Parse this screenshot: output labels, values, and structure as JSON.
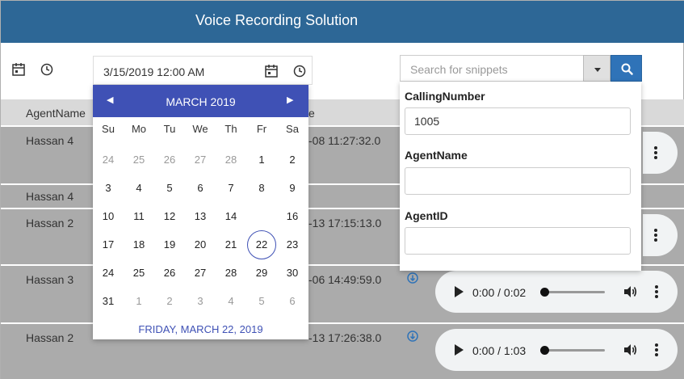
{
  "app": {
    "title": "Voice Recording Solution"
  },
  "filters": {
    "date_value": "3/15/2019 12:00 AM",
    "search_placeholder": "Search for snippets"
  },
  "table": {
    "headers": [
      "AgentName",
      "e"
    ],
    "rows": [
      {
        "agent": "Hassan 4",
        "datetime": "-08 11:27:32.0"
      },
      {
        "agent": "Hassan 4",
        "datetime": ""
      },
      {
        "agent": "Hassan 2",
        "datetime": "-13 17:15:13.0"
      },
      {
        "agent": "Hassan 3",
        "datetime": "-06 14:49:59.0",
        "player_time": "0:00 / 0:02",
        "progress": 0
      },
      {
        "agent": "Hassan 2",
        "datetime": "-13 17:26:38.0",
        "player_time": "0:00 / 1:03",
        "progress": 0
      }
    ]
  },
  "calendar": {
    "month_label": "MARCH 2019",
    "weekdays": [
      "Su",
      "Mo",
      "Tu",
      "We",
      "Th",
      "Fr",
      "Sa"
    ],
    "weeks": [
      [
        "24",
        "25",
        "26",
        "27",
        "28",
        "1",
        "2"
      ],
      [
        "3",
        "4",
        "5",
        "6",
        "7",
        "8",
        "9"
      ],
      [
        "10",
        "11",
        "12",
        "13",
        "14",
        "15",
        "16"
      ],
      [
        "17",
        "18",
        "19",
        "20",
        "21",
        "22",
        "23"
      ],
      [
        "24",
        "25",
        "26",
        "27",
        "28",
        "29",
        "30"
      ],
      [
        "31",
        "1",
        "2",
        "3",
        "4",
        "5",
        "6"
      ]
    ],
    "selected_day": "15",
    "today_day": "22",
    "footer": "FRIDAY, MARCH 22, 2019"
  },
  "snippet_filter": {
    "calling_number_label": "CallingNumber",
    "calling_number_value": "1005",
    "agent_name_label": "AgentName",
    "agent_name_value": "",
    "agent_id_label": "AgentID",
    "agent_id_value": ""
  },
  "colors": {
    "header": "#2d6796",
    "calendar_accent": "#3f51b5",
    "search_button": "#2f73b8"
  }
}
